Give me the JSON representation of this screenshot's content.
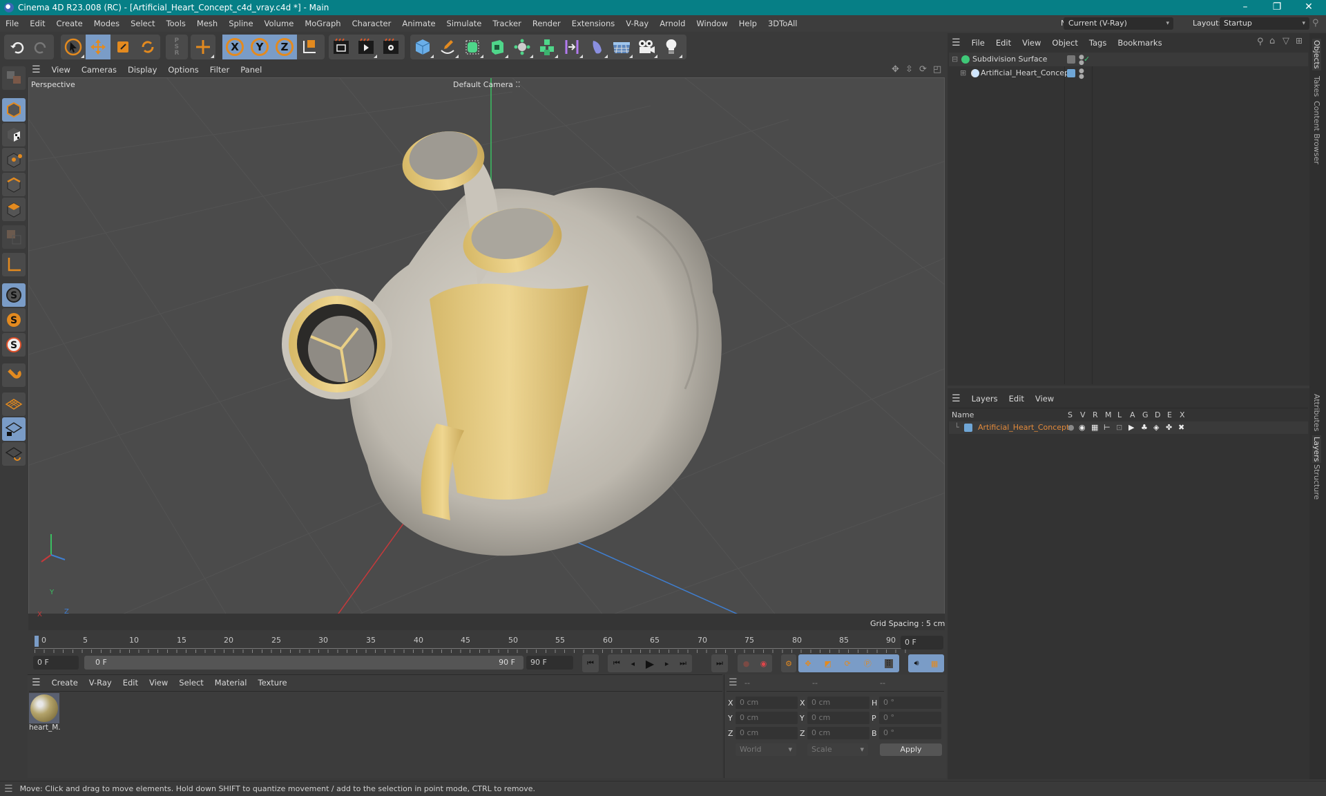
{
  "window": {
    "title": "Cinema 4D R23.008 (RC) - [Artificial_Heart_Concept_c4d_vray.c4d *] - Main",
    "controls": {
      "minimize": "–",
      "restore": "❐",
      "close": "✕"
    }
  },
  "menubar": {
    "items": [
      "File",
      "Edit",
      "Create",
      "Modes",
      "Select",
      "Tools",
      "Mesh",
      "Spline",
      "Volume",
      "MoGraph",
      "Character",
      "Animate",
      "Simulate",
      "Tracker",
      "Render",
      "Extensions",
      "V-Ray",
      "Arnold",
      "Window",
      "Help",
      "3DToAll"
    ],
    "node_space_label": "Node Space:",
    "node_space_value": "Current (V-Ray)",
    "layout_label": "Layout:",
    "layout_value": "Startup"
  },
  "toolbar": {
    "groups": [
      [
        "undo-icon",
        "redo-icon"
      ],
      [
        "select-icon",
        "move-icon",
        "scale-icon",
        "rotate-icon"
      ],
      [
        "psr-icon"
      ],
      [
        "last-tool-icon"
      ],
      [
        "x-axis-icon",
        "y-axis-icon",
        "z-axis-icon",
        "coordinate-system-icon"
      ],
      [
        "render-view-icon",
        "render-picture-viewer-icon",
        "render-settings-icon"
      ],
      [
        "cube-icon",
        "pen-icon",
        "subdivision-icon",
        "extrude-icon",
        "cloner-icon",
        "array-icon",
        "symmetry-icon",
        "deformer-icon",
        "floor-icon",
        "camera-icon",
        "light-icon"
      ]
    ],
    "axis_labels": [
      "X",
      "Y",
      "Z"
    ]
  },
  "left_tools": [
    "make-editable-icon",
    "model-mode-icon",
    "texture-mode-icon",
    "point-mode-icon",
    "edge-mode-icon",
    "polygon-mode-icon",
    "uvw-icon",
    "axis-icon",
    "snap-icon",
    "snap-settings-icon",
    "snap-workplane-icon",
    "magnet-icon",
    "workplane-icon",
    "locked-workplane-icon",
    "workplane-align-icon"
  ],
  "viewport": {
    "menu": [
      "View",
      "Cameras",
      "Display",
      "Options",
      "Filter",
      "Panel"
    ],
    "label": "Perspective",
    "camera": "Default Camera",
    "camera_icon": "⁚⁚",
    "grid_spacing": "Grid Spacing : 5 cm",
    "axis": {
      "x": "X",
      "y": "Y",
      "z": "Z"
    },
    "nav_icons": [
      "pan-icon",
      "dolly-icon",
      "orbit-icon",
      "maximize-icon"
    ],
    "colors": {
      "background": "#4b4b4b",
      "model_body": "#c9c4ba",
      "model_rings": "#e9cf86",
      "x_axis": "#c8393b",
      "y_axis": "#3bbf62",
      "z_axis": "#3f7fd2"
    }
  },
  "timeline": {
    "ticks": [
      "0",
      "5",
      "10",
      "15",
      "20",
      "25",
      "30",
      "35",
      "40",
      "45",
      "50",
      "55",
      "60",
      "65",
      "70",
      "75",
      "80",
      "85",
      "90"
    ],
    "current_frame": "0 F",
    "start_field": "0 F",
    "range_start": "0 F",
    "range_end": "90 F",
    "end_field": "90 F",
    "right_field": "0 F",
    "current_fraction": 0.0
  },
  "playback": [
    "go-to-start-icon",
    "prev-keyframe-icon",
    "prev-frame-icon",
    "play-icon",
    "next-frame-icon",
    "next-keyframe-icon",
    "go-to-end-icon",
    "record-disabled-icon",
    "autokey-icon",
    "keyframe-selection-icon",
    "key-position-icon",
    "key-scale-icon",
    "key-rotation-icon",
    "key-parameter-icon",
    "key-pla-icon",
    "sound-icon",
    "timeline-icon"
  ],
  "materials": {
    "menu": [
      "Create",
      "V-Ray",
      "Edit",
      "View",
      "Select",
      "Material",
      "Texture"
    ],
    "items": [
      {
        "name": "heart_M."
      }
    ]
  },
  "coordinates": {
    "headers": [
      "--",
      "--",
      "--"
    ],
    "rows": [
      {
        "l1": "X",
        "v1": "0 cm",
        "l2": "X",
        "v2": "0 cm",
        "l3": "H",
        "v3": "0 °"
      },
      {
        "l1": "Y",
        "v1": "0 cm",
        "l2": "Y",
        "v2": "0 cm",
        "l3": "P",
        "v3": "0 °"
      },
      {
        "l1": "Z",
        "v1": "0 cm",
        "l2": "Z",
        "v2": "0 cm",
        "l3": "B",
        "v3": "0 °"
      }
    ],
    "mode": "World",
    "transform": "Scale",
    "apply": "Apply"
  },
  "objects": {
    "menu": [
      "File",
      "Edit",
      "View",
      "Object",
      "Tags",
      "Bookmarks"
    ],
    "tree": [
      {
        "name": "Subdivision Surface",
        "icon": "subdivision-surface-icon",
        "expanded": true
      },
      {
        "name": "Artificial_Heart_Concept",
        "icon": "null-object-icon",
        "expanded": false
      }
    ]
  },
  "layers": {
    "menu": [
      "Layers",
      "Edit",
      "View"
    ],
    "columns": [
      "Name",
      "S",
      "V",
      "R",
      "M",
      "L",
      "A",
      "G",
      "D",
      "E",
      "X"
    ],
    "rows": [
      {
        "name": "Artificial_Heart_Concept",
        "color": "#6fa6d6"
      }
    ]
  },
  "side_tabs": {
    "top": [
      "Objects",
      "Takes",
      "Content Browser"
    ],
    "bottom": [
      "Attributes",
      "Layers",
      "Structure"
    ]
  },
  "status": "Move: Click and drag to move elements. Hold down SHIFT to quantize movement / add to the selection in point mode, CTRL to remove."
}
